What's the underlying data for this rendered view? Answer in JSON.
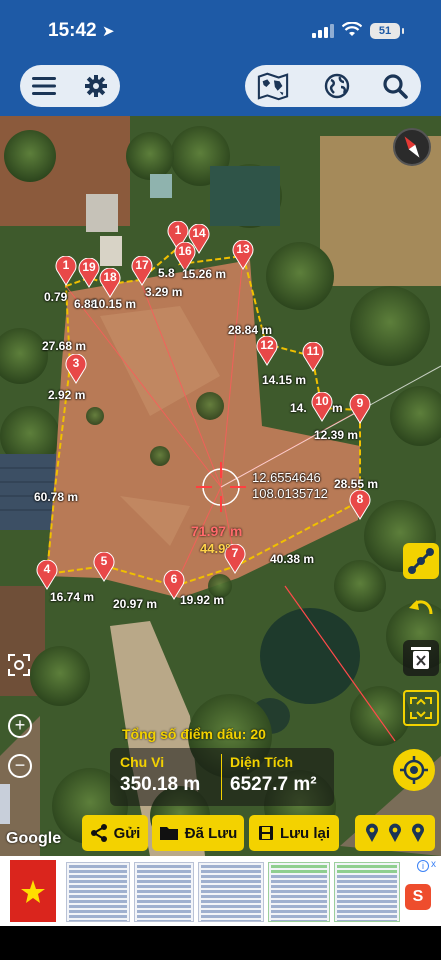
{
  "status": {
    "time": "15:42",
    "battery": "51"
  },
  "toolbar": {
    "menu_icon": "menu-icon",
    "settings_icon": "gear-icon",
    "map_icon": "world-map-icon",
    "globe_icon": "globe-icon",
    "search_icon": "search-icon"
  },
  "map": {
    "coordinates": {
      "lat": "12.6554646",
      "lng": "108.0135712"
    },
    "center_distance": "71.97 m",
    "center_percent": "44.9°",
    "markers": [
      {
        "num": "1"
      },
      {
        "num": "19"
      },
      {
        "num": "18"
      },
      {
        "num": "17"
      },
      {
        "num": "1"
      },
      {
        "num": "14"
      },
      {
        "num": "16"
      },
      {
        "num": "13"
      },
      {
        "num": "12"
      },
      {
        "num": "11"
      },
      {
        "num": "10"
      },
      {
        "num": "9"
      },
      {
        "num": "3"
      },
      {
        "num": "8"
      },
      {
        "num": "7"
      },
      {
        "num": "6"
      },
      {
        "num": "5"
      },
      {
        "num": "4"
      }
    ],
    "distances": [
      {
        "text": "0.79"
      },
      {
        "text": "6.88"
      },
      {
        "text": "10.15 m"
      },
      {
        "text": "3.29 m"
      },
      {
        "text": "5.8"
      },
      {
        "text": "15.26 m"
      },
      {
        "text": "27.68 m"
      },
      {
        "text": "2.92 m"
      },
      {
        "text": "28.84 m"
      },
      {
        "text": "14.15 m"
      },
      {
        "text": "14."
      },
      {
        "text": "m"
      },
      {
        "text": "12.39 m"
      },
      {
        "text": "28.55 m"
      },
      {
        "text": "60.78 m"
      },
      {
        "text": "40.38 m"
      },
      {
        "text": "16.74 m"
      },
      {
        "text": "20.97 m"
      },
      {
        "text": "19.92 m"
      }
    ],
    "total_label": "Tổng số điểm dấu:",
    "total_count": "20",
    "perimeter_label": "Chu Vi",
    "perimeter_value": "350.18 m",
    "area_label": "Diện Tích",
    "area_value": "6527.7 m²",
    "attribution": "Google"
  },
  "actions": {
    "send": "Gửi",
    "saved": "Đã Lưu",
    "save": "Lưu lại"
  },
  "ad": {
    "shop_letter": "S",
    "info": "i",
    "close": "x"
  }
}
